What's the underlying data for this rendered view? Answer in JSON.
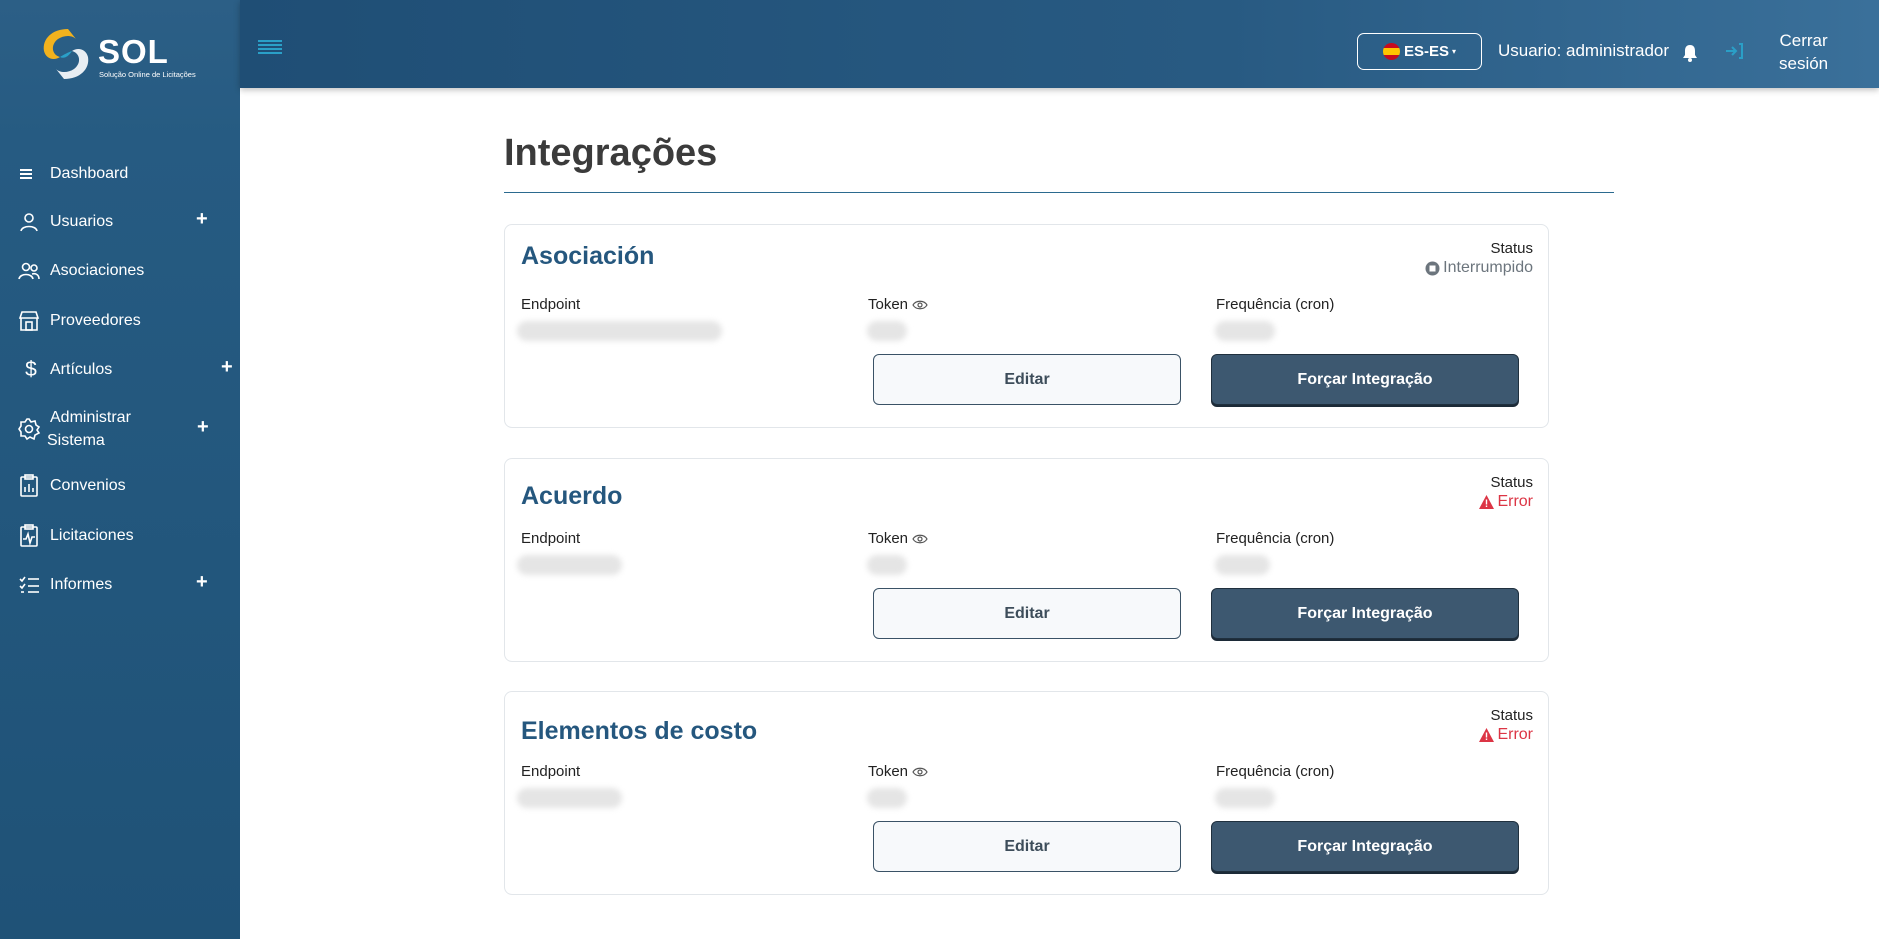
{
  "brand": {
    "name": "SOL",
    "tagline": "Solução Online de Licitações"
  },
  "sidebar": {
    "items": [
      {
        "label": "Dashboard",
        "icon": "menu-lines-icon",
        "expandable": false
      },
      {
        "label": "Usuarios",
        "icon": "user-icon",
        "expandable": true
      },
      {
        "label": "Asociaciones",
        "icon": "users-icon",
        "expandable": false
      },
      {
        "label": "Proveedores",
        "icon": "store-icon",
        "expandable": false
      },
      {
        "label": "Artículos",
        "icon": "dollar-icon",
        "expandable": true
      },
      {
        "label": "Administrar Sistema",
        "icon": "gear-icon",
        "expandable": true
      },
      {
        "label": "Convenios",
        "icon": "clipboard-chart-icon",
        "expandable": false
      },
      {
        "label": "Licitaciones",
        "icon": "clipboard-pulse-icon",
        "expandable": false
      },
      {
        "label": "Informes",
        "icon": "list-check-icon",
        "expandable": true
      }
    ],
    "plus_glyph": "+"
  },
  "header": {
    "language": "ES-ES",
    "user": "Usuario: administrador",
    "logout_line1": "Cerrar",
    "logout_line2": "sesión"
  },
  "page": {
    "title": "Integrações"
  },
  "integrations": [
    {
      "name": "Asociación",
      "status_label": "Status",
      "status": "Interrumpido",
      "status_kind": "interrupted",
      "endpoint_label": "Endpoint",
      "token_label": "Token",
      "cron_label": "Frequência (cron)",
      "edit_label": "Editar",
      "force_label": "Forçar Integração"
    },
    {
      "name": "Acuerdo",
      "status_label": "Status",
      "status": "Error",
      "status_kind": "error",
      "endpoint_label": "Endpoint",
      "token_label": "Token",
      "cron_label": "Frequência (cron)",
      "edit_label": "Editar",
      "force_label": "Forçar Integração"
    },
    {
      "name": "Elementos de costo",
      "status_label": "Status",
      "status": "Error",
      "status_kind": "error",
      "endpoint_label": "Endpoint",
      "token_label": "Token",
      "cron_label": "Frequência (cron)",
      "edit_label": "Editar",
      "force_label": "Forçar Integração"
    }
  ],
  "colors": {
    "sidebar": "#265b82",
    "topbar": "#285a82",
    "accent": "#2aa0c8",
    "card_title": "#25577e",
    "force_button": "#3d5870",
    "error": "#dc3545",
    "interrupted": "#6c757d"
  }
}
